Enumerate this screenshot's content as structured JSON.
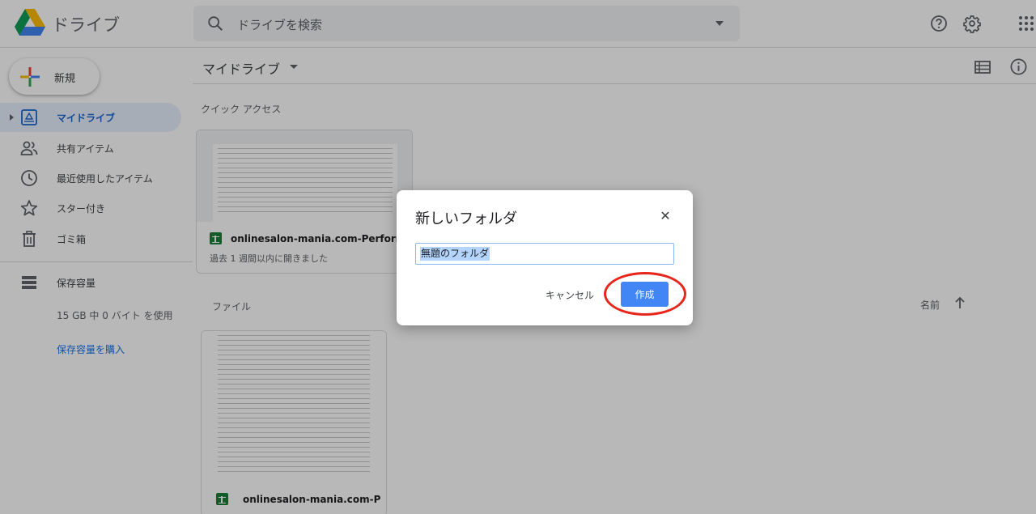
{
  "app": {
    "title": "ドライブ"
  },
  "search": {
    "placeholder": "ドライブを検索"
  },
  "header_icons": [
    "help-icon",
    "settings-icon",
    "apps-grid-icon"
  ],
  "sidebar": {
    "new_label": "新規",
    "items": [
      {
        "label": "マイドライブ",
        "icon": "my-drive-icon",
        "active": true
      },
      {
        "label": "共有アイテム",
        "icon": "shared-people-icon"
      },
      {
        "label": "最近使用したアイテム",
        "icon": "clock-icon"
      },
      {
        "label": "スター付き",
        "icon": "star-icon"
      },
      {
        "label": "ゴミ箱",
        "icon": "trash-icon"
      },
      {
        "label": "保存容量",
        "icon": "storage-icon"
      }
    ],
    "storage_used": "15 GB 中 0 バイト を使用",
    "buy_storage": "保存容量を購入"
  },
  "main": {
    "title": "マイドライブ",
    "quick_access_label": "クイック アクセス",
    "files_label": "ファイル",
    "sort_label": "名前",
    "quick_files": [
      {
        "name": "onlinesalon-mania.com-Performanc...",
        "subtitle": "過去 1 週間以内に開きました"
      }
    ],
    "files": [
      {
        "name": "onlinesalon-mania.com-Perf..."
      }
    ]
  },
  "dialog": {
    "title": "新しいフォルダ",
    "input_value": "無題のフォルダ",
    "cancel_label": "キャンセル",
    "create_label": "作成"
  },
  "colors": {
    "accent": "#1a73e8",
    "active_nav_bg": "#e8f0fe",
    "create_button": "#4285f4",
    "annotation_ring": "#e8251a",
    "sheets_green": "#188038"
  }
}
